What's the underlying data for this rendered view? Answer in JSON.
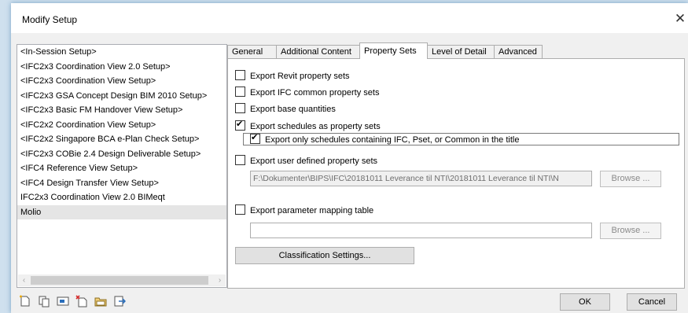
{
  "window": {
    "title": "Modify Setup",
    "close_glyph": "✕"
  },
  "setups": [
    "<In-Session Setup>",
    "<IFC2x3 Coordination View 2.0 Setup>",
    "<IFC2x3 Coordination View Setup>",
    "<IFC2x3 GSA Concept Design BIM 2010 Setup>",
    "<IFC2x3 Basic FM Handover View Setup>",
    "<IFC2x2 Coordination View Setup>",
    "<IFC2x2 Singapore BCA e-Plan Check Setup>",
    "<IFC2x3 COBie 2.4 Design Deliverable Setup>",
    "<IFC4 Reference View Setup>",
    "<IFC4 Design Transfer View Setup>",
    "IFC2x3 Coordination View 2.0 BIMeqt",
    "Molio"
  ],
  "selected_setup": "Molio",
  "toolbar_icons": [
    "new-setup-icon",
    "duplicate-setup-icon",
    "rename-setup-icon",
    "delete-setup-icon",
    "import-setup-icon",
    "export-setup-icon"
  ],
  "tabs": [
    "General",
    "Additional Content",
    "Property Sets",
    "Level of Detail",
    "Advanced"
  ],
  "active_tab": "Property Sets",
  "property_sets": {
    "export_revit": {
      "label": "Export Revit property sets",
      "checked": false
    },
    "export_ifc_common": {
      "label": "Export IFC common property sets",
      "checked": false
    },
    "export_base_quantities": {
      "label": "Export base quantities",
      "checked": false
    },
    "export_schedules": {
      "label": "Export schedules as property sets",
      "checked": true
    },
    "export_only_schedules": {
      "label": "Export only schedules containing IFC, Pset, or Common in the title",
      "checked": true
    },
    "export_user_defined": {
      "label": "Export user defined property sets",
      "checked": false
    },
    "user_defined_path": "F:\\Dokumenter\\BIPS\\IFC\\20181011 Leverance til NTI\\20181011 Leverance til NTI\\N",
    "browse_label": "Browse ...",
    "export_mapping": {
      "label": "Export parameter mapping table",
      "checked": false
    },
    "mapping_path": "",
    "classification_label": "Classification Settings..."
  },
  "buttons": {
    "ok": "OK",
    "cancel": "Cancel"
  },
  "scroll": {
    "left": "‹",
    "right": "›"
  }
}
